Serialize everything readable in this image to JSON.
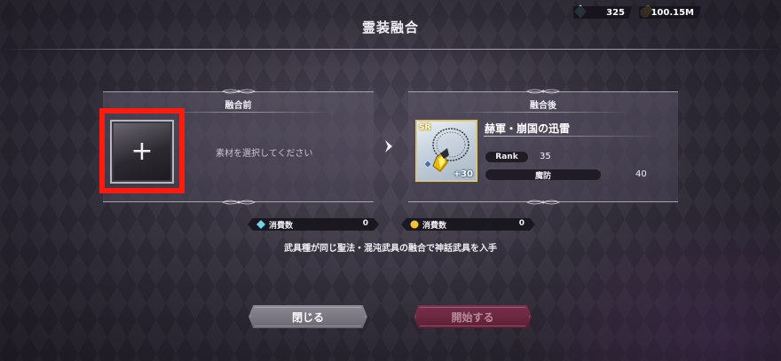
{
  "header": {
    "title": "霊装融合",
    "currency_gem": "325",
    "currency_gold": "100.15M"
  },
  "left_panel": {
    "title": "融合前",
    "add_symbol": "+",
    "hint": "素材を選択してください"
  },
  "right_panel": {
    "title": "融合後",
    "item": {
      "rarity": "SR",
      "name": "赫軍・崩国の迅雷",
      "plus_level": "+30",
      "rank_label": "Rank",
      "rank_value": "35",
      "stat_label": "魔防",
      "stat_value": "40"
    }
  },
  "consumption": {
    "gem_label": "消費数",
    "gem_value": "0",
    "gold_label": "消費数",
    "gold_value": "0"
  },
  "description": "武具種が同じ聖法・混沌武具の融合で神話武具を入手",
  "buttons": {
    "close": "閉じる",
    "start": "開始する"
  },
  "colors": {
    "highlight": "#ff1a0e",
    "start_button": "#6a2640",
    "gem": "#6fd6e8",
    "gold": "#f2c230"
  }
}
